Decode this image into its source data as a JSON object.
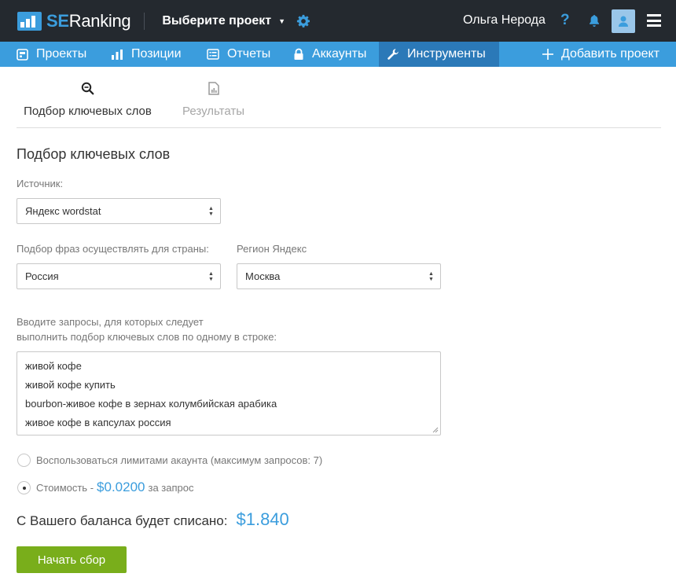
{
  "header": {
    "logo_se": "SE",
    "logo_ranking": "Ranking",
    "project_select": "Выберите проект",
    "user_name": "Ольга Нерода",
    "help": "?"
  },
  "nav": {
    "items": [
      {
        "label": "Проекты",
        "icon": "projects-icon"
      },
      {
        "label": "Позиции",
        "icon": "positions-chart-icon"
      },
      {
        "label": "Отчеты",
        "icon": "reports-list-icon"
      },
      {
        "label": "Аккаунты",
        "icon": "lock-icon"
      },
      {
        "label": "Инструменты",
        "icon": "wrench-icon",
        "active": true
      }
    ],
    "add_project": "Добавить проект"
  },
  "tabs": [
    {
      "label": "Подбор ключевых слов",
      "icon": "search-zoom-icon",
      "active": true
    },
    {
      "label": "Результаты",
      "icon": "report-doc-icon",
      "active": false
    }
  ],
  "form": {
    "title": "Подбор ключевых слов",
    "source_label": "Источник:",
    "source_value": "Яндекс wordstat",
    "country_label": "Подбор фраз осуществлять для страны:",
    "country_value": "Россия",
    "region_label": "Регион Яндекс",
    "region_value": "Москва",
    "queries_label_line1": "Вводите запросы, для которых следует",
    "queries_label_line2": "выполнить подбор ключевых слов по одному в строке:",
    "queries": [
      "живой кофе",
      "живой кофе купить",
      "bourbon-живое кофе в зернах колумбийская арабика",
      "живое кофе в капсулах россия"
    ],
    "option_limits": "Воспользоваться лимитами акаунта (максимум запросов: 7)",
    "option_cost_prefix": "Стоимость -",
    "option_cost_price": "$0.0200",
    "option_cost_suffix": "за запрос",
    "selected_option": "cost",
    "balance_label": "С Вашего баланса будет списано:",
    "balance_amount": "$1.840",
    "start_button": "Начать сбор"
  },
  "colors": {
    "topbar": "#24292f",
    "nav": "#3b9ddd",
    "nav_active": "#2b79b8",
    "accent": "#3b9ddd",
    "button": "#79ae1b"
  }
}
